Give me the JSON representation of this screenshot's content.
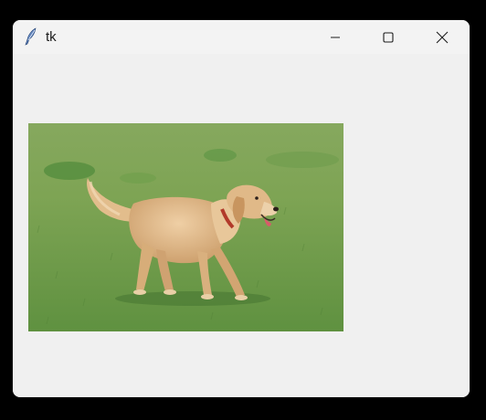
{
  "window": {
    "title": "tk",
    "app_icon": "tk-feather-icon",
    "controls": {
      "minimize_icon": "minimize-icon",
      "maximize_icon": "maximize-icon",
      "close_icon": "close-icon"
    }
  },
  "content": {
    "image_subject": "golden-retriever-on-grass",
    "colors": {
      "grass": "#6f9a4a",
      "dog": "#d9b07e",
      "window_bg": "#f0f0f0",
      "titlebar_bg": "#f3f3f3"
    }
  }
}
